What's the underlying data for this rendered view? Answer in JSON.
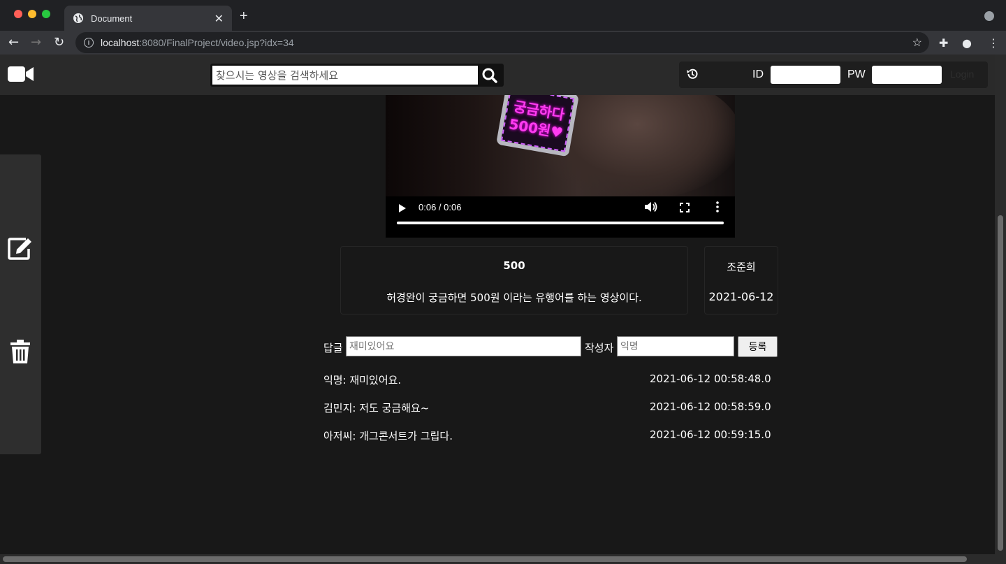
{
  "browser": {
    "tab_title": "Document",
    "url_host": "localhost",
    "url_path": ":8080/FinalProject/video.jsp?idx=34"
  },
  "header": {
    "search_placeholder": "찾으시는 영상을 검색하세요",
    "id_label": "ID",
    "pw_label": "PW",
    "login_label": "Login"
  },
  "video": {
    "overlay_line1": "궁금하다",
    "overlay_line2": "500원♥",
    "time_display": "0:06 / 0:06",
    "progress": 1.0
  },
  "info": {
    "title": "500",
    "description": "허경완이 궁금하면 500원 이라는 유행어를 하는 영상이다.",
    "author": "조준희",
    "date": "2021-06-12"
  },
  "comment_form": {
    "reply_label": "답글",
    "reply_placeholder": "재미있어요",
    "author_label": "작성자",
    "author_placeholder": "익명",
    "submit_label": "등록"
  },
  "comments": [
    {
      "text": "익명: 재미있어요.",
      "date": "2021-06-12 00:58:48.0"
    },
    {
      "text": "김민지: 저도 궁금해요~",
      "date": "2021-06-12 00:58:59.0"
    },
    {
      "text": "아저씨: 개그콘서트가 그립다.",
      "date": "2021-06-12 00:59:15.0"
    }
  ],
  "colors": {
    "page_bg": "#181818",
    "header_bg": "#2a2a2a",
    "sidebar_bg": "#2e2e2e"
  }
}
